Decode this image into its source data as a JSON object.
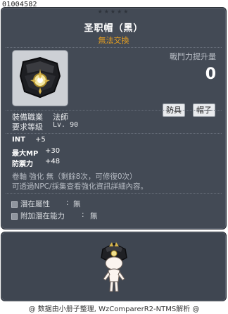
{
  "item_id": "01004582",
  "stars": "★★★★★",
  "item": {
    "name": "圣职帽（黑）",
    "trade": "無法交換"
  },
  "combat": {
    "label": "戰鬥力提升量",
    "value": "0"
  },
  "tags": [
    "防具",
    "帽子"
  ],
  "requirements": [
    {
      "label": "裝備職業",
      "value": "法師"
    },
    {
      "label": "要求等級",
      "value": "Lv. 90"
    }
  ],
  "stats": [
    {
      "label": "INT",
      "value": "+5"
    },
    {
      "label": "最大MP",
      "value": "+30"
    },
    {
      "label": "防禦力",
      "value": "+48"
    }
  ],
  "notes": [
    "卷軸 強化 無（剩餘8次，可修復0次）",
    "可透過NPC/採集查看強化資訊詳細內容。"
  ],
  "potential": [
    {
      "label": "潛在屬性",
      "value": "無"
    },
    {
      "label": "附加潛在能力",
      "value": "無"
    }
  ],
  "footer": "@ 数据由小册子整理, WzComparerR2-NTMS解析 @",
  "icons": {
    "item_icon": "black-clergy-hat-icon",
    "preview": "character-wearing-hat"
  },
  "colors": {
    "panel": "#434a55",
    "untradeable": "#e8a020",
    "icon_bg": "#cdd0d5"
  }
}
